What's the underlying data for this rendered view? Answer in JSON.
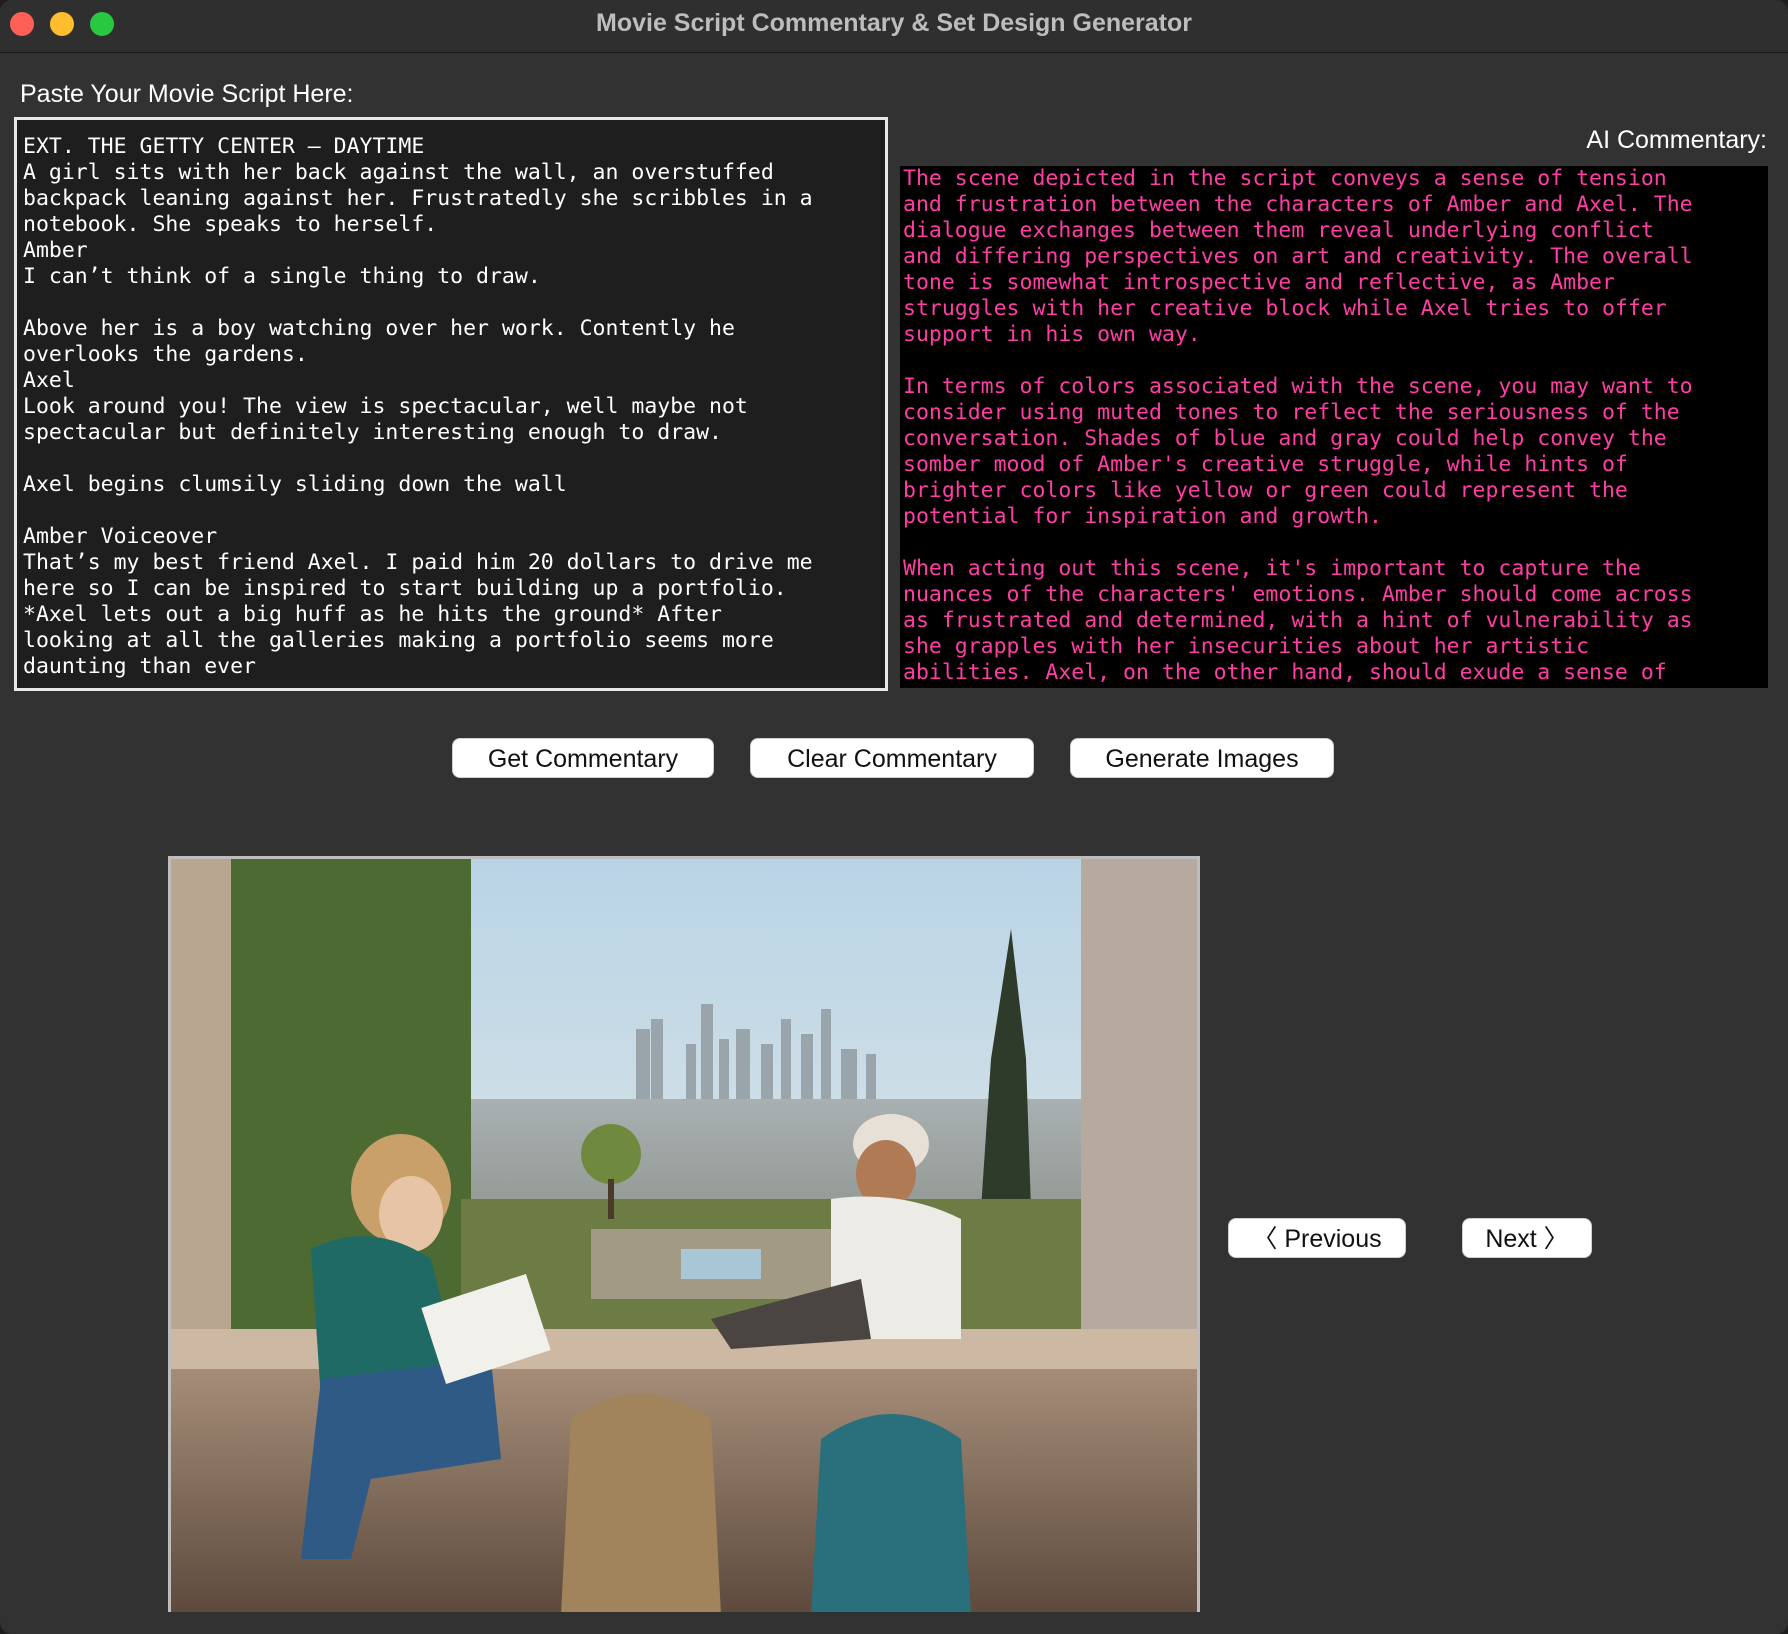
{
  "window": {
    "title": "Movie Script Commentary & Set Design Generator"
  },
  "script": {
    "label": "Paste Your Movie Script Here:",
    "text": "EXT. THE GETTY CENTER – DAYTIME\nA girl sits with her back against the wall, an overstuffed\nbackpack leaning against her. Frustratedly she scribbles in a\nnotebook. She speaks to herself.\nAmber\nI can’t think of a single thing to draw.\n\nAbove her is a boy watching over her work. Contently he\noverlooks the gardens.\nAxel\nLook around you! The view is spectacular, well maybe not\nspectacular but definitely interesting enough to draw.\n\nAxel begins clumsily sliding down the wall\n\nAmber Voiceover\nThat’s my best friend Axel. I paid him 20 dollars to drive me\nhere so I can be inspired to start building up a portfolio.\n*Axel lets out a big huff as he hits the ground* After\nlooking at all the galleries making a portfolio seems more\ndaunting than ever"
  },
  "commentary": {
    "label": "AI Commentary:",
    "text": "The scene depicted in the script conveys a sense of tension\nand frustration between the characters of Amber and Axel. The\ndialogue exchanges between them reveal underlying conflict\nand differing perspectives on art and creativity. The overall\ntone is somewhat introspective and reflective, as Amber\nstruggles with her creative block while Axel tries to offer\nsupport in his own way.\n\nIn terms of colors associated with the scene, you may want to\nconsider using muted tones to reflect the seriousness of the\nconversation. Shades of blue and gray could help convey the\nsomber mood of Amber's creative struggle, while hints of\nbrighter colors like yellow or green could represent the\npotential for inspiration and growth.\n\nWhen acting out this scene, it's important to capture the\nnuances of the characters' emotions. Amber should come across\nas frustrated and determined, with a hint of vulnerability as\nshe grapples with her insecurities about her artistic\nabilities. Axel, on the other hand, should exude a sense of",
    "text_color": "#ff3ea5"
  },
  "buttons": {
    "get_commentary": "Get Commentary",
    "clear_commentary": "Clear Commentary",
    "generate_images": "Generate Images",
    "previous": "〈 Previous",
    "next": "Next 〉"
  }
}
